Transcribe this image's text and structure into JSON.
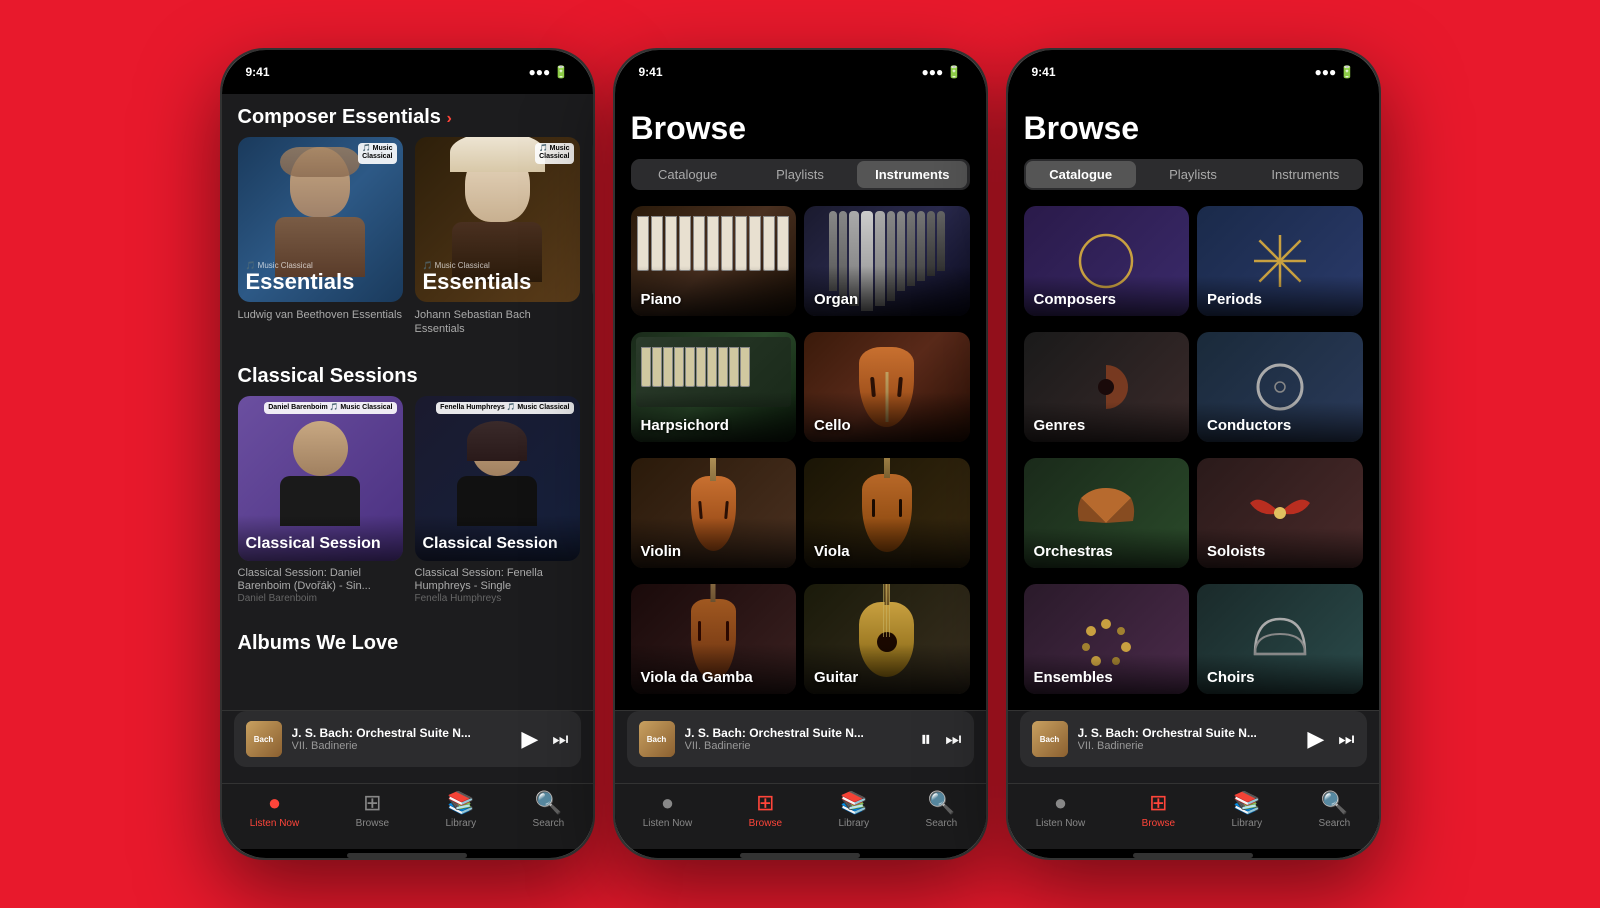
{
  "background_color": "#e8192c",
  "phones": [
    {
      "id": "phone1",
      "active_tab": "listen_now",
      "sections": [
        {
          "title": "Composer Essentials",
          "has_arrow": true,
          "cards": [
            {
              "title": "Essentials",
              "subtitle": "Ludwig van Beethoven Essentials",
              "badge": "Apple Music Classical",
              "color_from": "#1a3a5c",
              "color_to": "#2d5986"
            },
            {
              "title": "Essentials",
              "subtitle": "Johann Sebastian Bach Essentials",
              "badge": "Apple Music Classical",
              "color_from": "#2d1f0a",
              "color_to": "#5c3d1a"
            }
          ]
        },
        {
          "title": "Classical Sessions",
          "has_arrow": false,
          "cards": [
            {
              "label": "Classical Session",
              "subtitle": "Classical Session: Daniel Barenboim (Dvořák) - Sin...",
              "artist": "Daniel Barenboim",
              "color_from": "#6b4fa0",
              "color_to": "#4a3080"
            },
            {
              "label": "Classical Session",
              "subtitle": "Classical Session: Fenella Humphreys - Single",
              "artist": "Fenella Humphreys",
              "color_from": "#1a1a2e",
              "color_to": "#16213e"
            }
          ]
        },
        {
          "title": "Albums We Love",
          "has_arrow": false
        }
      ],
      "player": {
        "title": "J. S. Bach: Orchestral Suite N...",
        "subtitle": "VII. Badinerie",
        "is_playing": false
      },
      "tabs": [
        "Listen Now",
        "Browse",
        "Library",
        "Search"
      ],
      "active_tab_index": 0
    },
    {
      "id": "phone2",
      "page_title": "Browse",
      "active_segment": "Instruments",
      "segments": [
        "Catalogue",
        "Playlists",
        "Instruments"
      ],
      "instruments": [
        {
          "name": "Piano",
          "bg": "piano"
        },
        {
          "name": "Organ",
          "bg": "organ"
        },
        {
          "name": "Harpsichord",
          "bg": "harpsichord"
        },
        {
          "name": "Cello",
          "bg": "cello"
        },
        {
          "name": "Violin",
          "bg": "violin"
        },
        {
          "name": "Viola",
          "bg": "viola"
        },
        {
          "name": "Viola da Gamba",
          "bg": "viola-gamba"
        },
        {
          "name": "Guitar",
          "bg": "guitar"
        }
      ],
      "player": {
        "title": "J. S. Bach: Orchestral Suite N...",
        "subtitle": "VII. Badinerie",
        "is_playing": true
      },
      "tabs": [
        "Listen Now",
        "Browse",
        "Library",
        "Search"
      ],
      "active_tab_index": 1
    },
    {
      "id": "phone3",
      "page_title": "Browse",
      "active_segment": "Catalogue",
      "segments": [
        "Catalogue",
        "Playlists",
        "Instruments"
      ],
      "catalogue": [
        {
          "name": "Composers",
          "bg": "composers",
          "icon": "circle"
        },
        {
          "name": "Periods",
          "bg": "periods",
          "icon": "asterisk"
        },
        {
          "name": "Genres",
          "bg": "genres",
          "icon": "semicircle"
        },
        {
          "name": "Conductors",
          "bg": "conductors",
          "icon": "ring"
        },
        {
          "name": "Orchestras",
          "bg": "orchestras",
          "icon": "fan"
        },
        {
          "name": "Soloists",
          "bg": "soloists",
          "icon": "fan2"
        },
        {
          "name": "Ensembles",
          "bg": "ensembles",
          "icon": "dots"
        },
        {
          "name": "Choirs",
          "bg": "choirs",
          "icon": "dome"
        }
      ],
      "player": {
        "title": "J. S. Bach: Orchestral Suite N...",
        "subtitle": "VII. Badinerie",
        "is_playing": false
      },
      "tabs": [
        "Listen Now",
        "Browse",
        "Library",
        "Search"
      ],
      "active_tab_index": 1
    }
  ]
}
